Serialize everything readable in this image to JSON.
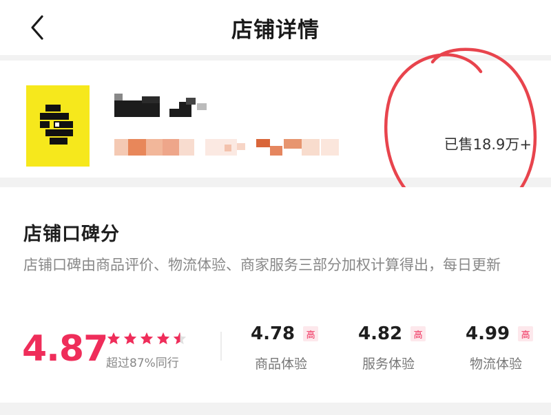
{
  "header": {
    "title": "店铺详情",
    "back_icon": "chevron-left-icon"
  },
  "store": {
    "sold_label": "已售18.9万+",
    "logo_color": "#f6e81c"
  },
  "reputation": {
    "title": "店铺口碑分",
    "description": "店铺口碑由商品评价、物流体验、商家服务三部分加权计算得出，每日更新",
    "overall_score": "4.87",
    "rating": 4.87,
    "rating_max": 5,
    "percentile_text": "超过87%同行",
    "accent_color": "#ef2d5a",
    "metrics": [
      {
        "value": "4.78",
        "badge": "高",
        "label": "商品体验"
      },
      {
        "value": "4.82",
        "badge": "高",
        "label": "服务体验"
      },
      {
        "value": "4.99",
        "badge": "高",
        "label": "物流体验"
      }
    ]
  }
}
